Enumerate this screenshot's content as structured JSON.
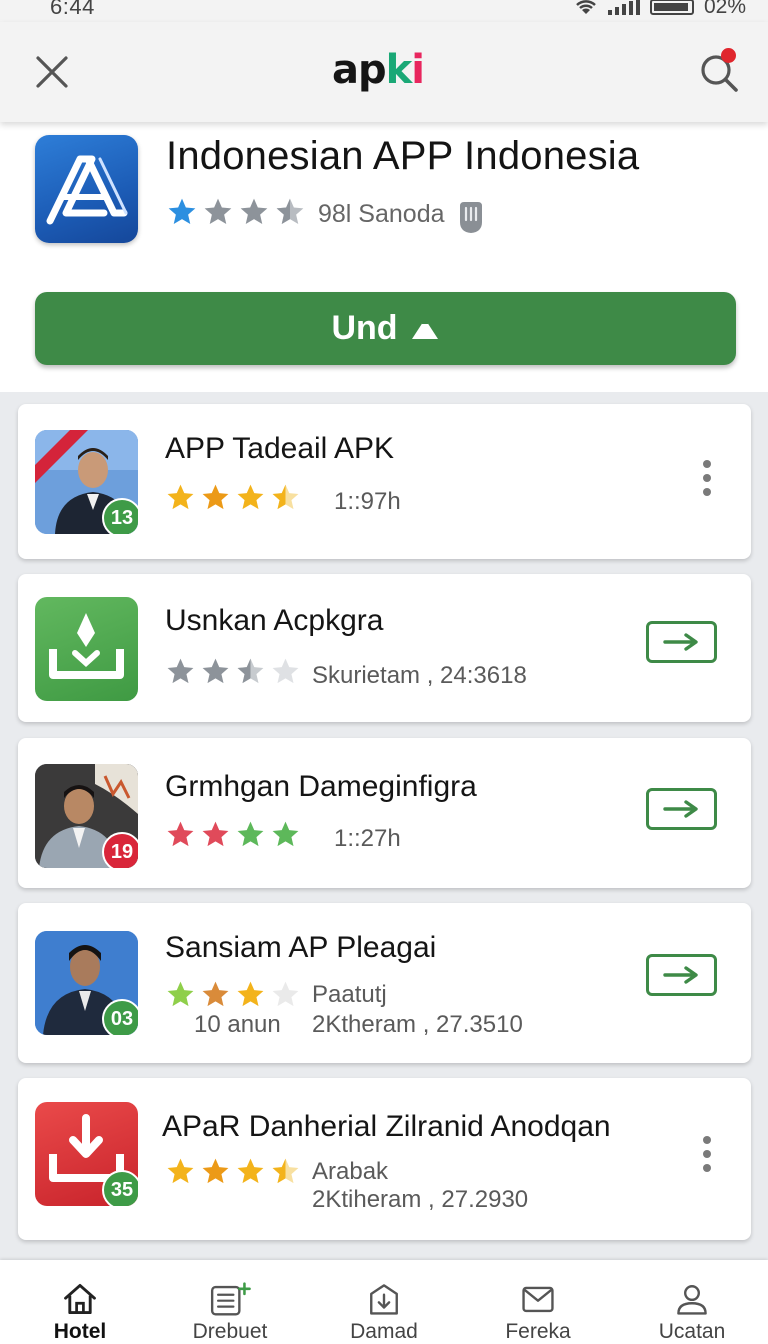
{
  "status_bar": {
    "time": "6:44",
    "battery": "02%"
  },
  "app_bar": {
    "logo_parts": [
      "ap",
      "k",
      "i"
    ]
  },
  "featured": {
    "title": "Indonesian APP Indonesia",
    "rating_stars": 3.5,
    "meta": "98l Sanoda",
    "install_label": "Und"
  },
  "apps": [
    {
      "title": "APP Tadeail APK",
      "meta_line1": "1::97h",
      "meta_line2": "",
      "badge": "13",
      "badge_color": "#3e9b47",
      "action": "more",
      "star_colors": [
        "#f3b31b",
        "#f0a31a",
        "#f3b31b",
        "#f6c94a"
      ]
    },
    {
      "title": "Usnkan Acpkgra",
      "meta_line1": "Skurietam , 24:3618",
      "meta_line2": "",
      "badge": "",
      "badge_color": "",
      "action": "open",
      "star_colors": [
        "#8d939a",
        "#8d939a",
        "#8d939a",
        "#c4c8cc"
      ]
    },
    {
      "title": "Grmhgan Dameginfigra",
      "meta_line1": "1::27h",
      "meta_line2": "",
      "badge": "19",
      "badge_color": "#d9263a",
      "action": "open",
      "star_colors": [
        "#e04a5a",
        "#e04a5a",
        "#5db85a",
        "#5db85a"
      ]
    },
    {
      "title": "Sansiam AP Pleagai",
      "meta_line1": "Paatutj",
      "meta_line2": "2Ktheram , 27.3510",
      "meta_prefix": "10 anun",
      "badge": "03",
      "badge_color": "#3e9b47",
      "action": "open",
      "star_colors": [
        "#8fcf4a",
        "#d98b3a",
        "#f3b31b",
        "#e3e3e3"
      ]
    },
    {
      "title": "APaR Danherial Zilranid Anodqan",
      "meta_line1": "Arabak",
      "meta_line2": "2Ktiheram , 27.2930",
      "badge": "35",
      "badge_color": "#3e9b47",
      "action": "more",
      "star_colors": [
        "#f3b31b",
        "#f0a31a",
        "#f3b31b",
        "#f6c94a"
      ]
    }
  ],
  "bottom_nav": [
    {
      "label": "Hotel",
      "icon": "home-icon"
    },
    {
      "label": "Drebuet",
      "icon": "list-add-icon"
    },
    {
      "label": "Damad",
      "icon": "download-box-icon"
    },
    {
      "label": "Fereka",
      "icon": "mail-icon"
    },
    {
      "label": "Ucatan",
      "icon": "profile-icon"
    }
  ],
  "colors": {
    "accent": "#3e8a47",
    "featured_icon": "#2e7ed8",
    "notification": "#e0262d"
  }
}
